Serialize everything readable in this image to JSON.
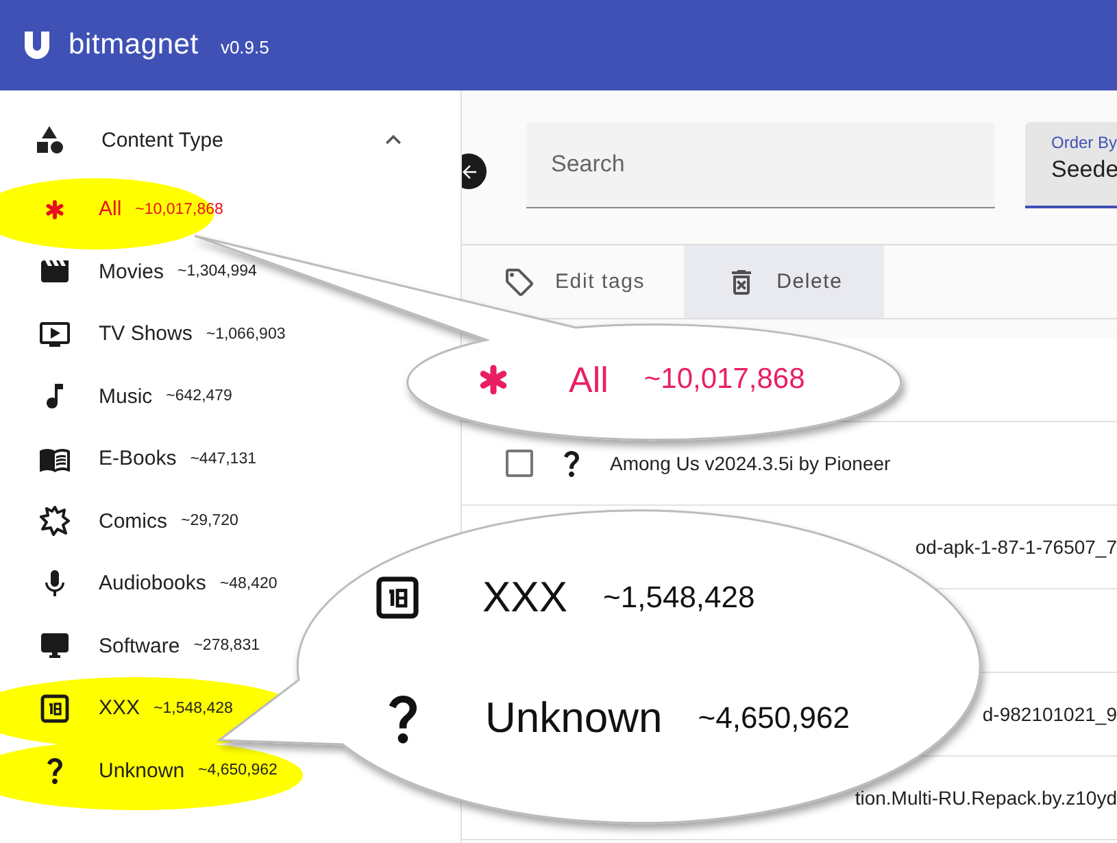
{
  "app": {
    "name": "bitmagnet",
    "version": "v0.9.5"
  },
  "sidebar": {
    "section": {
      "title": "Content Type",
      "expanded": true
    },
    "items": [
      {
        "kind": "all",
        "label": "All",
        "count": "~10,017,868",
        "selected": true,
        "highlighted": true
      },
      {
        "kind": "movie",
        "label": "Movies",
        "count": "~1,304,994",
        "selected": false,
        "highlighted": false
      },
      {
        "kind": "tv",
        "label": "TV Shows",
        "count": "~1,066,903",
        "selected": false,
        "highlighted": false
      },
      {
        "kind": "music",
        "label": "Music",
        "count": "~642,479",
        "selected": false,
        "highlighted": false
      },
      {
        "kind": "ebook",
        "label": "E-Books",
        "count": "~447,131",
        "selected": false,
        "highlighted": false
      },
      {
        "kind": "comic",
        "label": "Comics",
        "count": "~29,720",
        "selected": false,
        "highlighted": false
      },
      {
        "kind": "audiobook",
        "label": "Audiobooks",
        "count": "~48,420",
        "selected": false,
        "highlighted": false
      },
      {
        "kind": "software",
        "label": "Software",
        "count": "~278,831",
        "selected": false,
        "highlighted": false
      },
      {
        "kind": "xxx",
        "label": "XXX",
        "count": "~1,548,428",
        "selected": false,
        "highlighted": true
      },
      {
        "kind": "unknown",
        "label": "Unknown",
        "count": "~4,650,962",
        "selected": false,
        "highlighted": true
      }
    ]
  },
  "search": {
    "placeholder": "Search"
  },
  "order_by": {
    "label": "Order By",
    "value": "Seede"
  },
  "actions": [
    {
      "kind": "tag",
      "label": "Edit tags",
      "hovered": false
    },
    {
      "kind": "delete",
      "label": "Delete",
      "hovered": true
    }
  ],
  "rows": [
    {
      "kind": "unknown",
      "checked": false,
      "title": "Among Us v2024.3.5i by Pioneer"
    },
    {
      "kind": "fragment",
      "title": "od-apk-1-87-1-76507_7"
    },
    {
      "kind": "fragment",
      "title": "d-982101021_9"
    },
    {
      "kind": "fragment",
      "title": "tion.Multi-RU.Repack.by.z10yd"
    }
  ],
  "callouts": [
    {
      "items": [
        {
          "kind": "all",
          "label": "All",
          "count": "~10,017,868",
          "selected": true
        }
      ]
    },
    {
      "items": [
        {
          "kind": "xxx",
          "label": "XXX",
          "count": "~1,548,428",
          "selected": false
        },
        {
          "kind": "unknown",
          "label": "Unknown",
          "count": "~4,650,962",
          "selected": false
        }
      ]
    }
  ]
}
